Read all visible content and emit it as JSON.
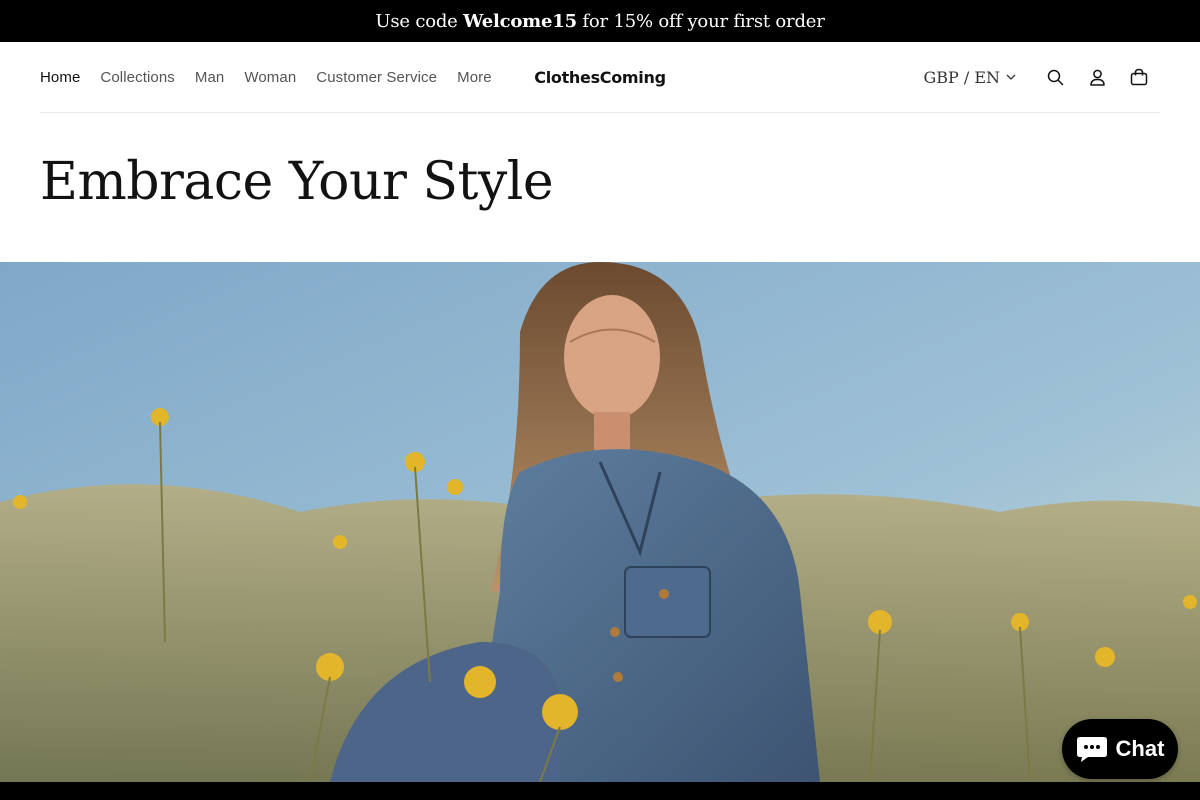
{
  "announcement": {
    "prefix": "Use code ",
    "code": "Welcome15",
    "suffix": " for 15% off your first order"
  },
  "nav": {
    "items": [
      {
        "label": "Home",
        "active": true
      },
      {
        "label": "Collections",
        "active": false
      },
      {
        "label": "Man",
        "active": false
      },
      {
        "label": "Woman",
        "active": false
      },
      {
        "label": "Customer Service",
        "active": false
      },
      {
        "label": "More",
        "active": false
      }
    ]
  },
  "brand": {
    "logo_text": "ClothesComing"
  },
  "header_actions": {
    "locale_label": "GBP / EN",
    "icons": [
      "search-icon",
      "account-icon",
      "cart-icon"
    ]
  },
  "hero": {
    "title": "Embrace Your Style",
    "image_description": "woman-in-denim-jacket-in-wildflower-field"
  },
  "chat": {
    "label": "Chat",
    "icon": "chat-bubble-icon"
  },
  "colors": {
    "announcement_bg": "#000000",
    "text_primary": "#121212",
    "text_muted": "#555555",
    "chat_bg": "#000000"
  }
}
